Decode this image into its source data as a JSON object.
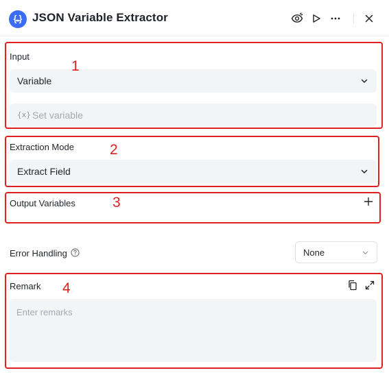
{
  "header": {
    "title": "JSON Variable Extractor",
    "logo_icon": "braces-icon",
    "action_icons": [
      "eye-icon",
      "play-icon",
      "more-icon",
      "close-icon"
    ]
  },
  "input_section": {
    "label": "Input",
    "select_value": "Variable",
    "variable_prefix": "{x}",
    "variable_placeholder": "Set variable"
  },
  "extraction_section": {
    "label": "Extraction Mode",
    "select_value": "Extract Field"
  },
  "output_section": {
    "label": "Output Variables"
  },
  "error_section": {
    "label": "Error Handling",
    "select_value": "None"
  },
  "remark_section": {
    "label": "Remark",
    "placeholder": "Enter remarks"
  },
  "annotations": [
    "1",
    "2",
    "3",
    "4"
  ],
  "colors": {
    "accent": "#3b6cf6",
    "annotation_red": "#e02020",
    "field_bg": "#f3f4f6",
    "placeholder": "#a4a8ae"
  }
}
